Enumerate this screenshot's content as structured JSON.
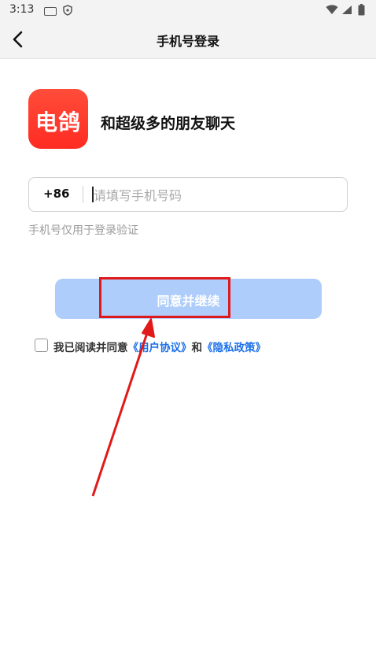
{
  "status_bar": {
    "time": "3:13",
    "icons": [
      "keyboard-icon",
      "shield-icon",
      "wifi-icon",
      "signal-icon",
      "battery-icon"
    ]
  },
  "header": {
    "title": "手机号登录",
    "back_icon": "chevron-left-icon"
  },
  "app": {
    "logo_text": "电鸽",
    "tagline": "和超级多的朋友聊天",
    "brand_color": "#ff3b2c"
  },
  "phone": {
    "country_code": "+86",
    "placeholder": "请填写手机号码",
    "value": "",
    "hint": "手机号仅用于登录验证"
  },
  "continue_button": {
    "label": "同意并继续",
    "color": "#aecdfa"
  },
  "agreement": {
    "prefix": "我已阅读并同意",
    "user_agreement": "《用户协议》",
    "conjunction": "和",
    "privacy_policy": "《隐私政策》",
    "link_color": "#1a6fe8"
  },
  "annotation": {
    "color": "#e01a1a",
    "icon": "arrow-up-icon"
  }
}
